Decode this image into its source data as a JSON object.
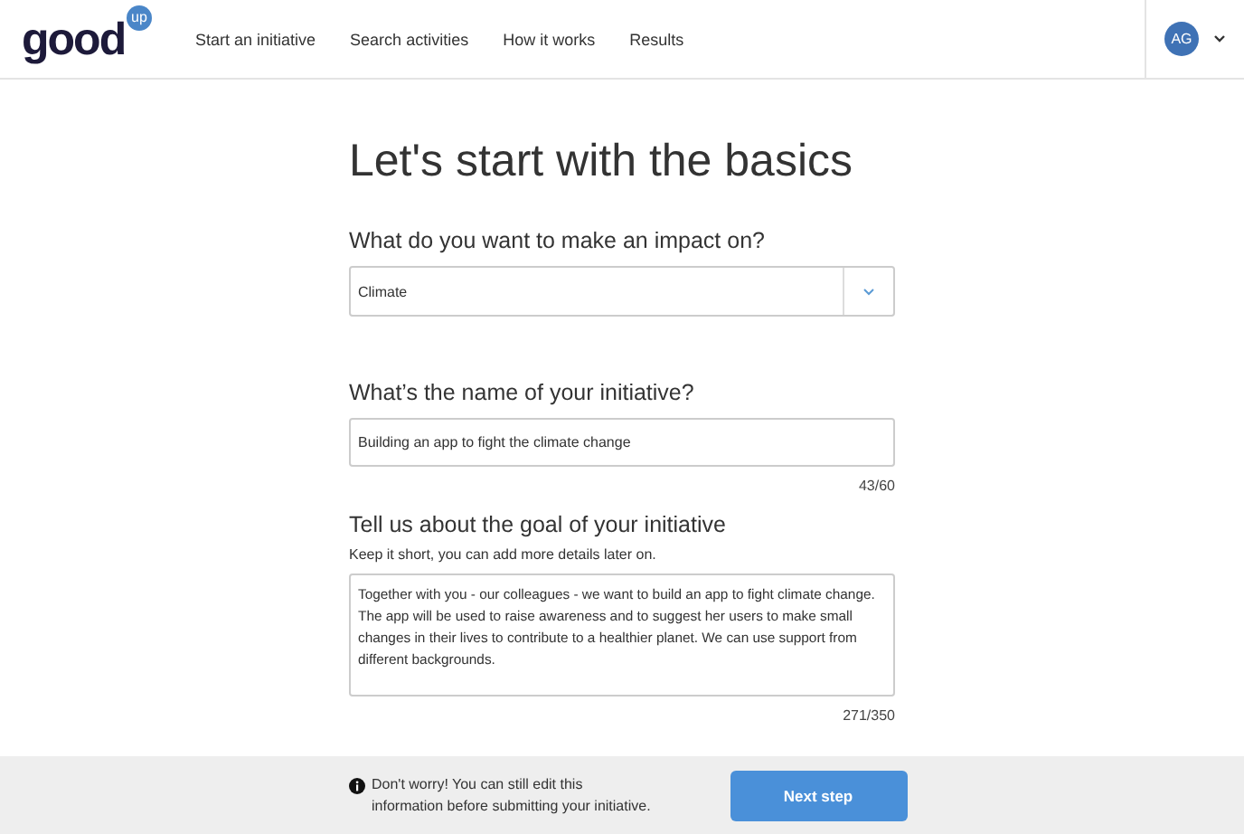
{
  "header": {
    "logo": "good",
    "logo_badge": "up",
    "nav": [
      {
        "label": "Start an initiative"
      },
      {
        "label": "Search activities"
      },
      {
        "label": "How it works"
      },
      {
        "label": "Results"
      }
    ],
    "user_initials": "AG"
  },
  "title": "Let's start with the basics",
  "fields": [
    {
      "kind": "select",
      "label": "What do you want to make an impact on?",
      "value": "Climate"
    },
    {
      "kind": "input",
      "label": "What’s the name of your initiative?",
      "value": "Building an app to fight the climate change",
      "counter": "43/60"
    },
    {
      "kind": "textarea",
      "label": "Tell us about the goal of your initiative",
      "hint": "Keep it short, you can add more details later on.",
      "value": "Together with you - our colleagues - we want to build an app to fight climate change. The app will be used to raise awareness and to suggest her users to make small changes in their lives to contribute to a healthier planet. We can use support from different backgrounds.",
      "counter": "271/350"
    }
  ],
  "footer": {
    "notice": "Don't worry! You can still edit this information before submitting your initiative.",
    "button": "Next step"
  }
}
